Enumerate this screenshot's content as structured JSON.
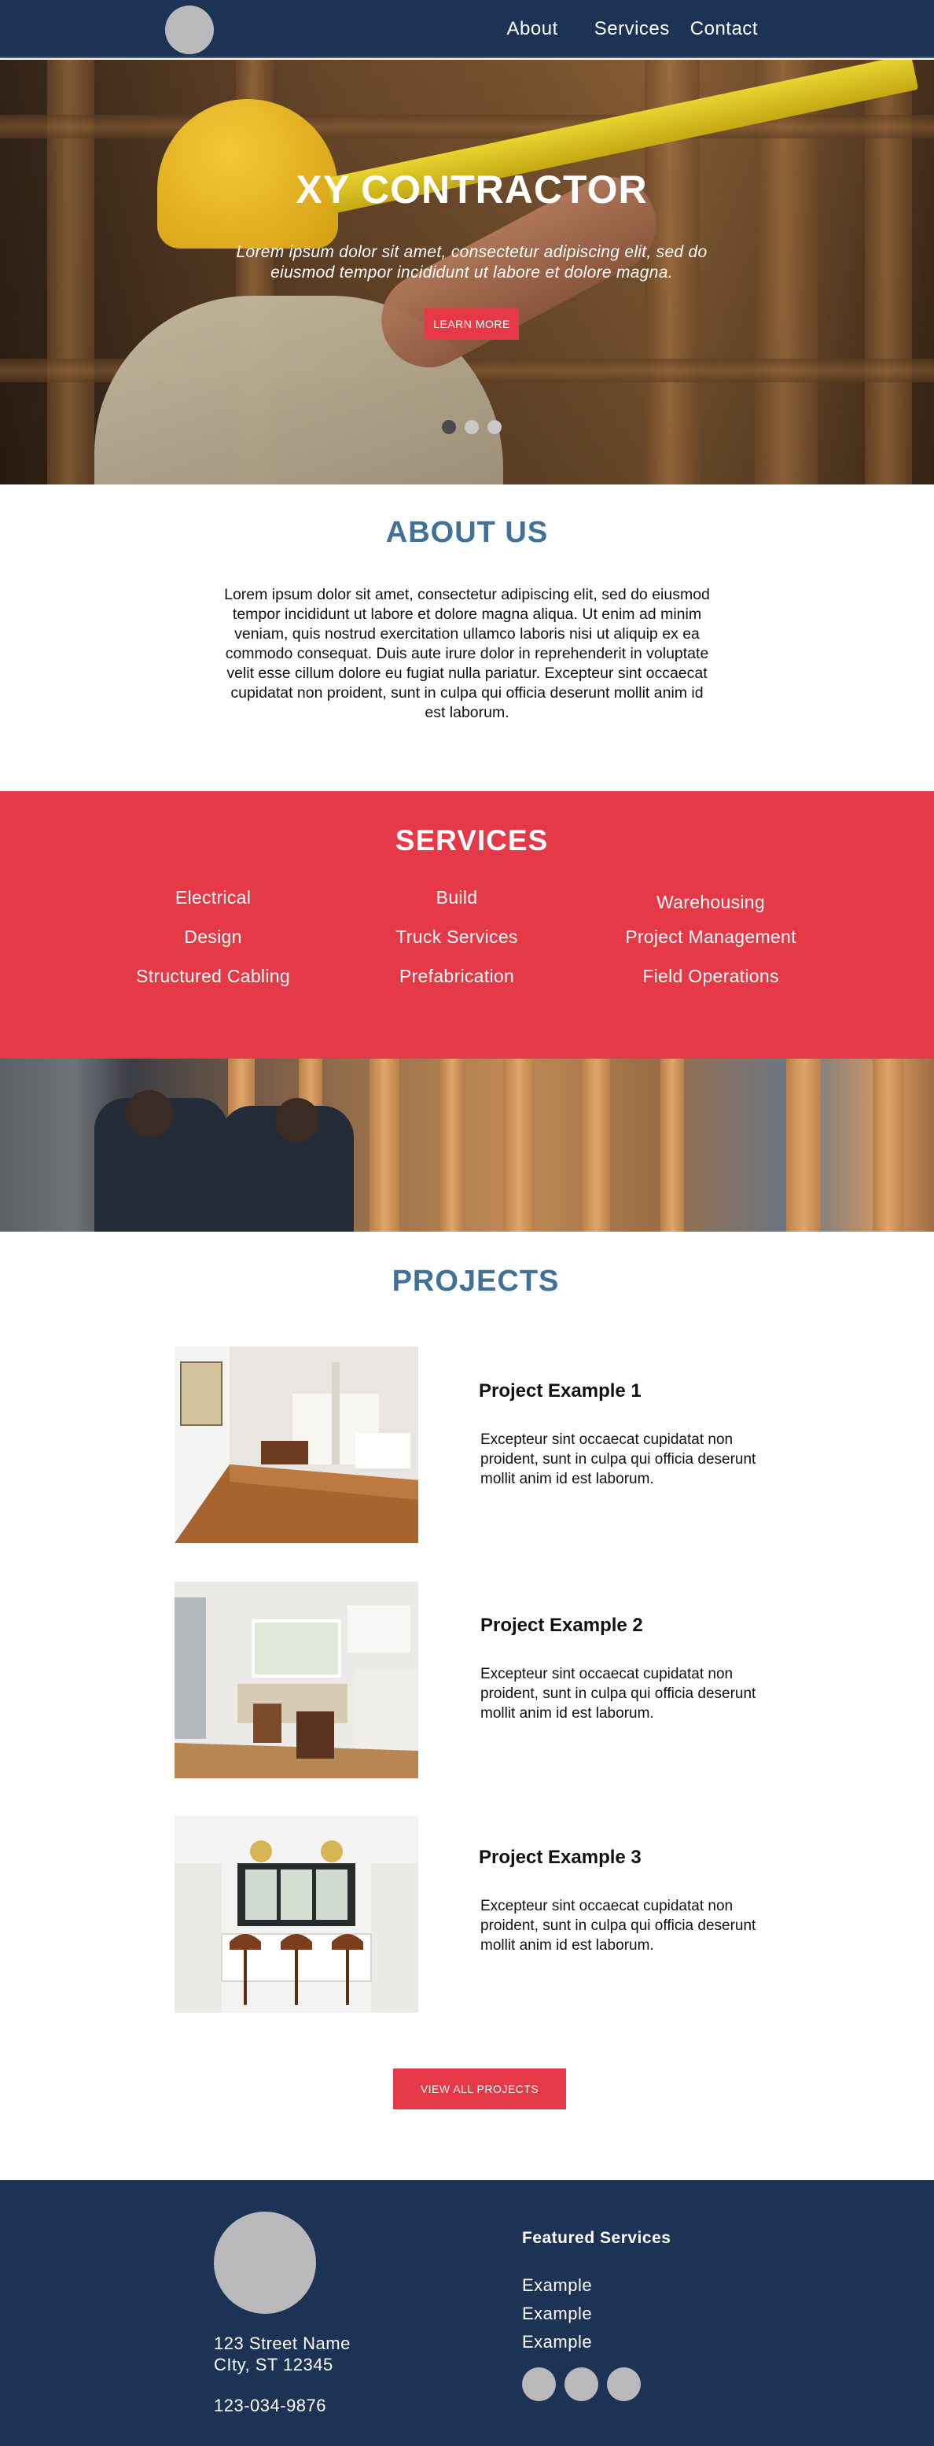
{
  "nav": {
    "links": [
      "About",
      "Services",
      "Contact"
    ]
  },
  "hero": {
    "title": "XY CONTRACTOR",
    "subtitle": "Lorem ipsum dolor sit amet, consectetur adipiscing elit, sed do eiusmod tempor incididunt ut labore et dolore magna.",
    "button": "LEARN MORE",
    "slides": 3,
    "active_slide": 1
  },
  "about": {
    "title": "ABOUT US",
    "text": "Lorem ipsum dolor sit amet, consectetur adipiscing elit, sed do eiusmod tempor incididunt ut labore et dolore magna aliqua. Ut enim ad minim veniam, quis nostrud exercitation ullamco laboris nisi ut aliquip ex ea commodo consequat. Duis aute irure dolor in reprehenderit in voluptate velit esse cillum dolore eu fugiat nulla pariatur. Excepteur sint occaecat cupidatat non proident, sunt in culpa qui officia deserunt mollit anim id est laborum."
  },
  "services": {
    "title": "SERVICES",
    "items": [
      "Electrical",
      "Build",
      "Warehousing",
      "Design",
      "Truck Services",
      "Project Management",
      "Structured Cabling",
      "Prefabrication",
      "Field Operations"
    ]
  },
  "projects": {
    "title": "PROJECTS",
    "items": [
      {
        "name": "Project Example 1",
        "desc": "Excepteur sint occaecat cupidatat non proident, sunt in culpa qui officia deserunt mollit anim id est laborum."
      },
      {
        "name": "Project Example 2",
        "desc": "Excepteur sint occaecat cupidatat non proident, sunt in culpa qui officia deserunt mollit anim id est laborum."
      },
      {
        "name": "Project Example 3",
        "desc": "Excepteur sint occaecat cupidatat non proident, sunt in culpa qui officia deserunt mollit anim id est laborum."
      }
    ],
    "button": "VIEW ALL PROJECTS"
  },
  "footer": {
    "address_line1": "123 Street Name",
    "address_line2": "CIty, ST 12345",
    "phone": "123-034-9876",
    "featured_title": "Featured Services",
    "featured_items": [
      "Example",
      "Example",
      "Example"
    ],
    "social_icons": [
      "social-icon-1",
      "social-icon-2",
      "social-icon-3"
    ]
  },
  "colors": {
    "navy": "#1d3356",
    "accent_red": "#e53947",
    "heading_blue": "#3f7199",
    "placeholder_gray": "#b9b9bb"
  }
}
